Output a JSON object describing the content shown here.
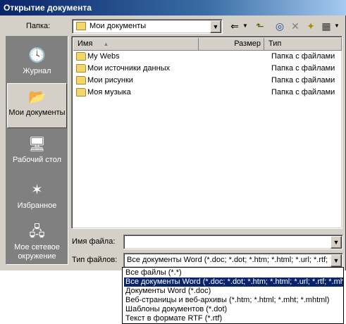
{
  "window": {
    "title": "Открытие документа"
  },
  "toolbar": {
    "folder_label": "Папка:",
    "folder_value": "Мои документы",
    "folder_icon": "my-documents-icon",
    "buttons": [
      {
        "name": "back-icon",
        "glyph": "⇐"
      },
      {
        "name": "up-folder-icon",
        "glyph": "⬑"
      },
      {
        "name": "search-web-icon",
        "glyph": "◎"
      },
      {
        "name": "delete-icon",
        "glyph": "✕"
      },
      {
        "name": "new-folder-icon",
        "glyph": "✦"
      },
      {
        "name": "views-icon",
        "glyph": "▦"
      }
    ]
  },
  "places": [
    {
      "label": "Журнал",
      "icon": "history-icon",
      "glyph": "🕓"
    },
    {
      "label": "Мои документы",
      "icon": "my-documents-icon",
      "glyph": "📂",
      "active": true
    },
    {
      "label": "Рабочий стол",
      "icon": "desktop-icon",
      "glyph": "🖥"
    },
    {
      "label": "Избранное",
      "icon": "favorites-icon",
      "glyph": "✶"
    },
    {
      "label": "Мое сетевое окружение",
      "icon": "network-icon",
      "glyph": "🖧"
    }
  ],
  "filelist": {
    "columns": {
      "name": "Имя",
      "size": "Размер",
      "type": "Тип"
    },
    "rows": [
      {
        "name": "My Webs",
        "type": "Папка с файлами"
      },
      {
        "name": "Мои источники данных",
        "type": "Папка с файлами"
      },
      {
        "name": "Мои рисунки",
        "type": "Папка с файлами"
      },
      {
        "name": "Моя музыка",
        "type": "Папка с файлами"
      }
    ]
  },
  "filename": {
    "label": "Имя файла:",
    "value": ""
  },
  "filetype": {
    "label": "Тип файлов:",
    "value": "Все документы Word (*.doc; *.dot; *.htm; *.html; *.url; *.rtf; *.mht; *.mhtml; *.xml)",
    "options": [
      {
        "label": "Все файлы (*.*)"
      },
      {
        "label": "Все документы Word (*.doc; *.dot; *.htm; *.html; *.url; *.rtf; *.mht; *.mhtml; *.xml)",
        "selected": true
      },
      {
        "label": "Документы Word (*.doc)"
      },
      {
        "label": "Веб-страницы и веб-архивы (*.htm; *.html; *.mht; *.mhtml)"
      },
      {
        "label": "Шаблоны документов (*.dot)"
      },
      {
        "label": "Текст в формате RTF (*.rtf)"
      }
    ]
  }
}
